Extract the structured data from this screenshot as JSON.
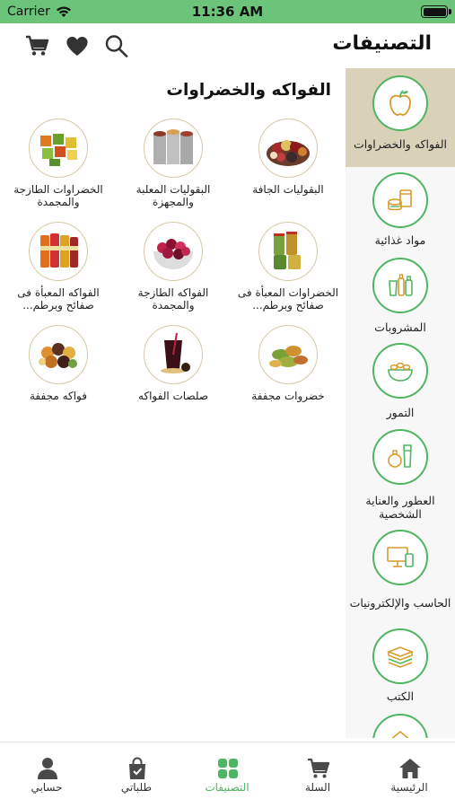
{
  "status_bar": {
    "carrier": "Carrier",
    "time": "11:36 AM"
  },
  "header": {
    "title": "التصنيفات",
    "icons": [
      "cart-icon",
      "heart-icon",
      "search-icon"
    ]
  },
  "sidebar": {
    "items": [
      {
        "label": "الفواكه والخضراوات",
        "icon": "apple-icon",
        "selected": true
      },
      {
        "label": "مواد غذائية",
        "icon": "groceries-icon",
        "selected": false
      },
      {
        "label": "المشروبات",
        "icon": "bottles-icon",
        "selected": false
      },
      {
        "label": "التمور",
        "icon": "dates-bowl-icon",
        "selected": false
      },
      {
        "label": "العطور والعناية الشخصية",
        "icon": "perfume-icon",
        "selected": false
      },
      {
        "label": "الحاسب والإلكترونيات",
        "icon": "computer-icon",
        "selected": false
      },
      {
        "label": "الكتب",
        "icon": "books-icon",
        "selected": false
      },
      {
        "label": "",
        "icon": "house-icon",
        "selected": false
      }
    ]
  },
  "content": {
    "section_title": "الفواكه والخضراوات",
    "categories": [
      {
        "name": "البقوليات الجافة"
      },
      {
        "name": "البقوليات المعلبة والمجهزة"
      },
      {
        "name": "الخضراوات الطازجة والمجمدة"
      },
      {
        "name": "الخضراوات المعبأة فى صفائح وبرطم..."
      },
      {
        "name": "الفواكه الطازجة والمجمدة"
      },
      {
        "name": "الفواكه المعبأة فى صفائح وبرطم..."
      },
      {
        "name": "خضروات مجففة"
      },
      {
        "name": "صلصات الفواكه"
      },
      {
        "name": "فواكه مجففة"
      }
    ]
  },
  "tabbar": {
    "tabs": [
      {
        "label": "الرئيسية",
        "icon": "home-icon",
        "active": false
      },
      {
        "label": "السلة",
        "icon": "cart-icon",
        "active": false
      },
      {
        "label": "التصنيفات",
        "icon": "grid-icon",
        "active": true
      },
      {
        "label": "طلباتي",
        "icon": "shopping-bag-icon",
        "active": false
      },
      {
        "label": "حسابي",
        "icon": "person-icon",
        "active": false
      }
    ]
  },
  "colors": {
    "accent": "#4fb563",
    "status_bar": "#6cc47a",
    "selected_sidebar": "#d9d1b8"
  }
}
